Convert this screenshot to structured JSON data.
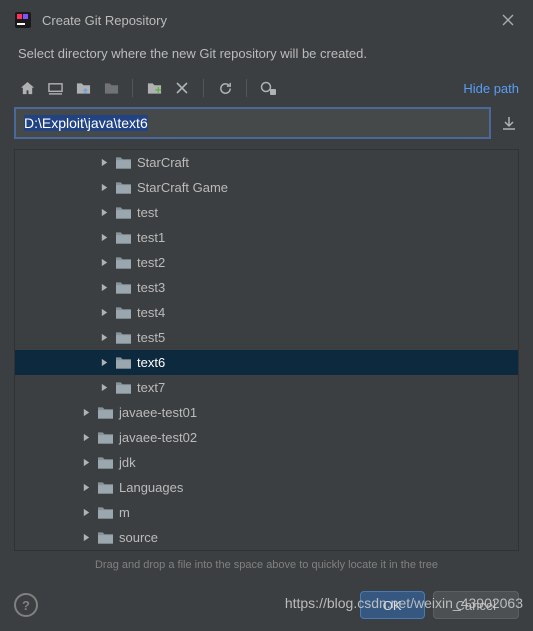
{
  "titlebar": {
    "title": "Create Git Repository"
  },
  "subtitle": "Select directory where the new Git repository will be created.",
  "toolbar": {
    "hide_path": "Hide path"
  },
  "path": {
    "value": "D:\\Exploit\\java\\text6"
  },
  "tree": {
    "items": [
      {
        "label": "StarCraft",
        "indent": 3,
        "selected": false
      },
      {
        "label": "StarCraft Game",
        "indent": 3,
        "selected": false
      },
      {
        "label": "test",
        "indent": 3,
        "selected": false
      },
      {
        "label": "test1",
        "indent": 3,
        "selected": false
      },
      {
        "label": "test2",
        "indent": 3,
        "selected": false
      },
      {
        "label": "test3",
        "indent": 3,
        "selected": false
      },
      {
        "label": "test4",
        "indent": 3,
        "selected": false
      },
      {
        "label": "test5",
        "indent": 3,
        "selected": false
      },
      {
        "label": "text6",
        "indent": 3,
        "selected": true
      },
      {
        "label": "text7",
        "indent": 3,
        "selected": false
      },
      {
        "label": "javaee-test01",
        "indent": 2,
        "selected": false
      },
      {
        "label": "javaee-test02",
        "indent": 2,
        "selected": false
      },
      {
        "label": "jdk",
        "indent": 2,
        "selected": false
      },
      {
        "label": "Languages",
        "indent": 2,
        "selected": false
      },
      {
        "label": "m",
        "indent": 2,
        "selected": false
      },
      {
        "label": "source",
        "indent": 2,
        "selected": false
      }
    ]
  },
  "hint": "Drag and drop a file into the space above to quickly locate it in the tree",
  "footer": {
    "ok": "OK",
    "cancel": "Cancel"
  },
  "watermark": "https://blog.csdn.net/weixin_43902063"
}
